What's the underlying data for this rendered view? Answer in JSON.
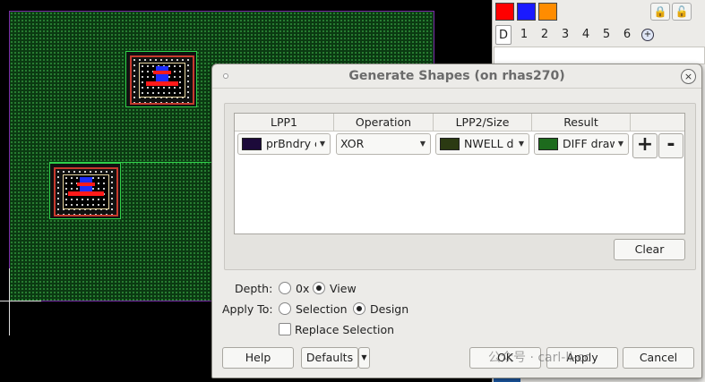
{
  "toolbar": {
    "swatches": [
      {
        "name": "red",
        "color": "#ff0000"
      },
      {
        "name": "blue",
        "color": "#1a1aff"
      },
      {
        "name": "orange",
        "color": "#ff8c00"
      }
    ],
    "depth_tabs": [
      "D",
      "1",
      "2",
      "3",
      "4",
      "5",
      "6"
    ],
    "active_tab": "D"
  },
  "dialog": {
    "title": "Generate Shapes (on rhas270)",
    "close_glyph": "×",
    "table": {
      "headers": [
        "LPP1",
        "Operation",
        "LPP2/Size",
        "Result"
      ],
      "row": {
        "lpp1": {
          "text": "prBndry c",
          "color": "#1c0a3a"
        },
        "operation": "XOR",
        "lpp2": {
          "text": "NWELL dr",
          "color": "#2b3a12"
        },
        "result": {
          "text": "DIFF draw",
          "color": "#1d6b1d"
        }
      },
      "add_label": "+",
      "remove_label": "-"
    },
    "clear_label": "Clear",
    "depth": {
      "label": "Depth:",
      "options": [
        "0x",
        "View"
      ],
      "selected": "View"
    },
    "apply_to": {
      "label": "Apply To:",
      "options": [
        "Selection",
        "Design"
      ],
      "selected": "Design"
    },
    "replace_selection": {
      "label": "Replace Selection",
      "checked": false
    },
    "buttons": {
      "help": "Help",
      "defaults": "Defaults",
      "ok": "OK",
      "apply": "Apply",
      "cancel": "Cancel"
    }
  },
  "watermark": "公众号 · carl-li-cc"
}
